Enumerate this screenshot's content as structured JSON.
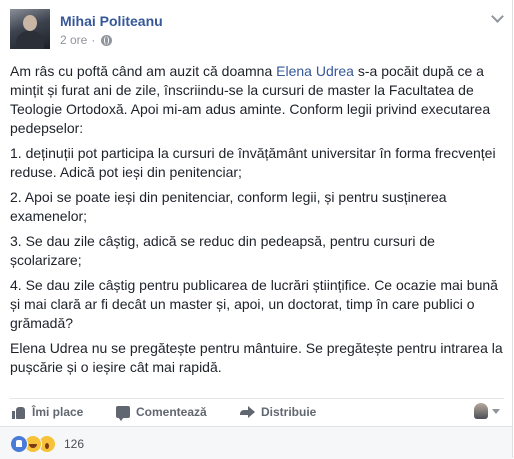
{
  "post": {
    "author": "Mihai Politeanu",
    "time": "2 ore",
    "visibility_icon": "globe-icon",
    "menu_icon": "chevron-down-icon",
    "content": {
      "p1_before": "Am râs cu poftă când am auzit că doamna ",
      "p1_link": "Elena Udrea",
      "p1_after": " s-a pocăit după ce a mințit și furat ani de zile, înscriindu-se la cursuri de master la Facultatea de Teologie Ortodoxă. Apoi mi-am adus aminte. Conform legii privind executarea pedepselor:",
      "p2": "1. deținuții pot participa la cursuri de învățământ universitar în forma frecvenței reduse. Adică pot ieși din penitenciar;",
      "p3": "2. Apoi se poate ieși din penitenciar, conform legii, și pentru susținerea examenelor;",
      "p4": "3. Se dau zile câștig, adică se reduc din pedeapsă, pentru cursuri de școlarizare;",
      "p5": "4. Se dau zile câștig pentru publicarea de lucrări științifice. Ce ocazie mai bună și mai clară ar fi decât un master și, apoi, un doctorat, timp în care publici o grămadă?",
      "p6": "Elena Udrea nu se pregătește pentru mântuire. Se pregătește pentru intrarea la pușcărie și o ieșire cât mai rapidă."
    }
  },
  "actions": {
    "like": "Îmi place",
    "comment": "Comentează",
    "share": "Distribuie"
  },
  "reactions": {
    "types": [
      "like",
      "haha",
      "wow"
    ],
    "count": "126"
  }
}
